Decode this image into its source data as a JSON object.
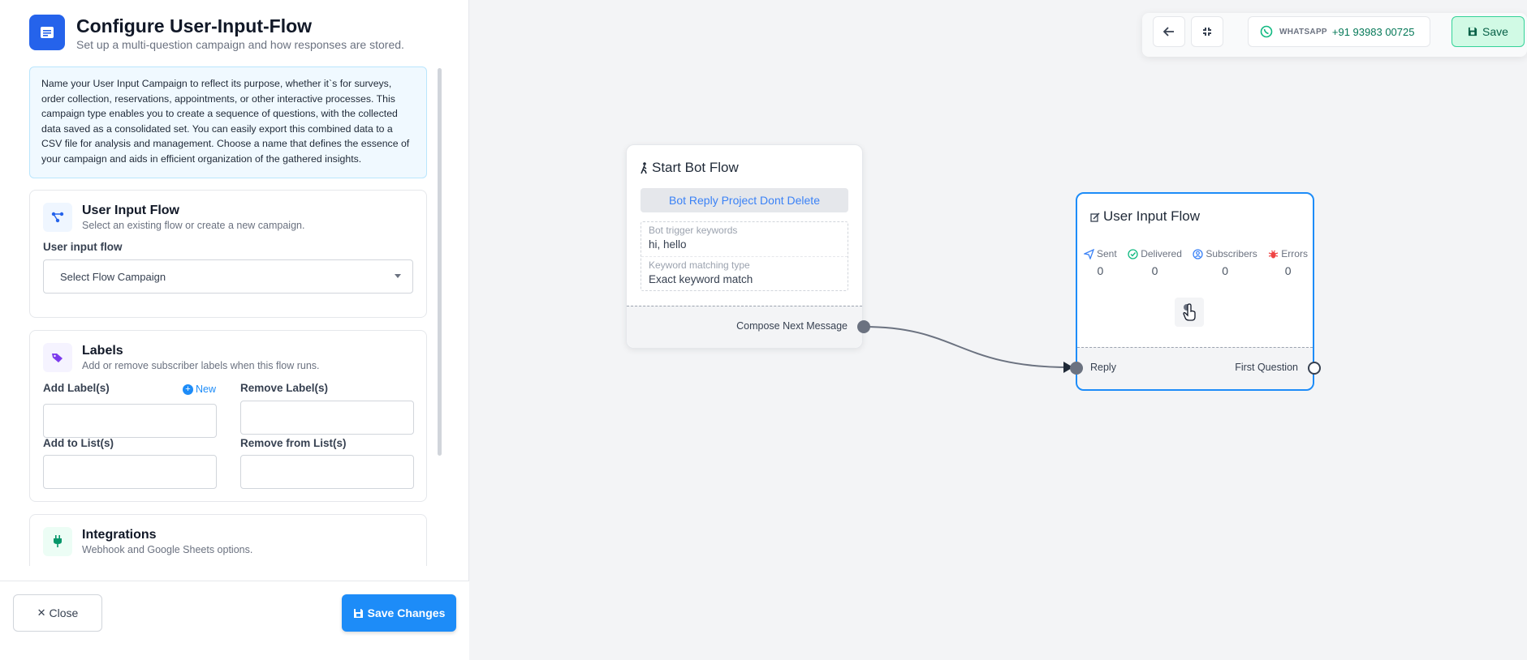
{
  "panel": {
    "title": "Configure User-Input-Flow",
    "subtitle": "Set up a multi-question campaign and how responses are stored.",
    "info": "Name your User Input Campaign to reflect its purpose, whether it`s for surveys, order collection, reservations, appointments, or other interactive processes. This campaign type enables you to create a sequence of questions, with the collected data saved as a consolidated set. You can easily export this combined data to a CSV file for analysis and management. Choose a name that defines the essence of your campaign and aids in efficient organization of the gathered insights.",
    "flow_card": {
      "title": "User Input Flow",
      "subtitle": "Select an existing flow or create a new campaign.",
      "field_label": "User input flow",
      "select_value": "Select Flow Campaign"
    },
    "labels_card": {
      "title": "Labels",
      "subtitle": "Add or remove subscriber labels when this flow runs.",
      "add_label": "Add Label(s)",
      "new_link": "New",
      "remove_label": "Remove Label(s)",
      "add_list": "Add to List(s)",
      "remove_list": "Remove from List(s)"
    },
    "integrations_card": {
      "title": "Integrations",
      "subtitle": "Webhook and Google Sheets options."
    },
    "close_button": "Close",
    "save_changes_button": "Save Changes"
  },
  "toolbar": {
    "channel_label": "WHATSAPP",
    "phone": "+91 93983 00725",
    "save_label": "Save"
  },
  "start_node": {
    "title": "Start Bot Flow",
    "reply_chip": "Bot Reply Project Dont Delete",
    "trigger_label": "Bot trigger keywords",
    "trigger_value": "hi, hello",
    "match_label": "Keyword matching type",
    "match_value": "Exact keyword match",
    "footer_label": "Compose Next Message"
  },
  "uif_node": {
    "title": "User Input Flow",
    "stats": [
      {
        "label": "Sent",
        "value": "0",
        "color": "#3b82f6"
      },
      {
        "label": "Delivered",
        "value": "0",
        "color": "#10b981"
      },
      {
        "label": "Subscribers",
        "value": "0",
        "color": "#3b82f6"
      },
      {
        "label": "Errors",
        "value": "0",
        "color": "#ef4444"
      }
    ],
    "reply_label": "Reply",
    "first_question_label": "First Question"
  },
  "colors": {
    "accent": "#1d8cf8",
    "success": "#10b981",
    "danger": "#ef4444"
  }
}
